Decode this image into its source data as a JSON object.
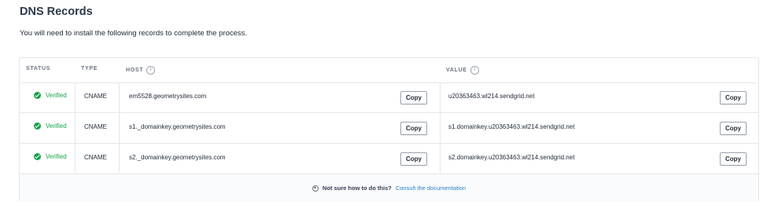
{
  "section": {
    "title": "DNS Records",
    "subtitle": "You will need to install the following records to complete the process."
  },
  "table": {
    "columns": {
      "status": "STATUS",
      "type": "TYPE",
      "host": "HOST",
      "value": "VALUE"
    },
    "rows": [
      {
        "status": "Verified",
        "type": "CNAME",
        "host": "em5528.geometrysites.com",
        "value": "u20363463.wl214.sendgrid.net"
      },
      {
        "status": "Verified",
        "type": "CNAME",
        "host": "s1._domainkey.geometrysites.com",
        "value": "s1.domainkey.u20363463.wl214.sendgrid.net"
      },
      {
        "status": "Verified",
        "type": "CNAME",
        "host": "s2._domainkey.geometrysites.com",
        "value": "s2.domainkey.u20363463.wl214.sendgrid.net"
      }
    ],
    "copy_label": "Copy",
    "status_color": "#16a34a"
  },
  "footer": {
    "help_text": "Not sure how to do this?",
    "link_text": "Consult the documentation",
    "link_color": "#2f80c9"
  },
  "icons": {
    "info": "info-icon",
    "status": "check-circle-icon",
    "help": "lifebuoy-icon"
  }
}
